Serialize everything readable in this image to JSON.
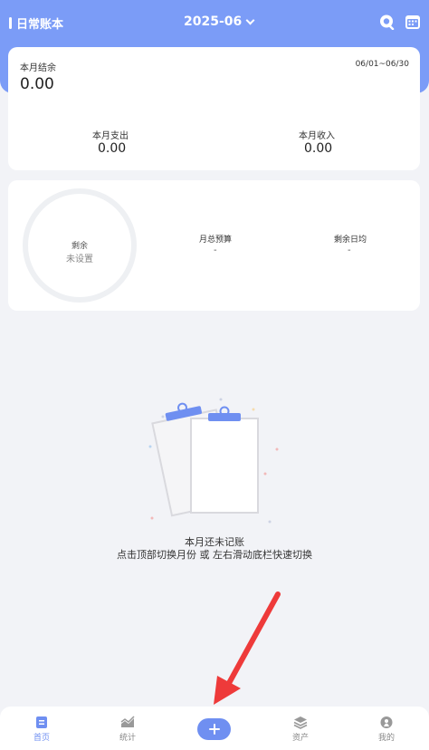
{
  "header": {
    "book_name": "日常账本",
    "month": "2025-06"
  },
  "summary": {
    "balance_label": "本月结余",
    "balance_value": "0.00",
    "date_range": "06/01~06/30",
    "expense_label": "本月支出",
    "expense_value": "0.00",
    "income_label": "本月收入",
    "income_value": "0.00"
  },
  "budget": {
    "remaining_label": "剩余",
    "remaining_value": "未设置",
    "total_label": "月总预算",
    "total_value": "-",
    "daily_label": "剩余日均",
    "daily_value": "-"
  },
  "empty_state": {
    "title": "本月还未记账",
    "hint": "点击顶部切换月份 或 左右滑动底栏快速切换"
  },
  "tabbar": {
    "items": [
      {
        "label": "首页",
        "icon": "home-doc-icon",
        "active": true
      },
      {
        "label": "统计",
        "icon": "chart-icon",
        "active": false
      },
      {
        "label": "",
        "icon": "plus-icon",
        "active": false
      },
      {
        "label": "资产",
        "icon": "layers-icon",
        "active": false
      },
      {
        "label": "我的",
        "icon": "user-icon",
        "active": false
      }
    ]
  },
  "colors": {
    "accent": "#6f8ff1",
    "header": "#7b9cf7",
    "background": "#f2f3f7",
    "arrow": "#ee3a3a"
  }
}
